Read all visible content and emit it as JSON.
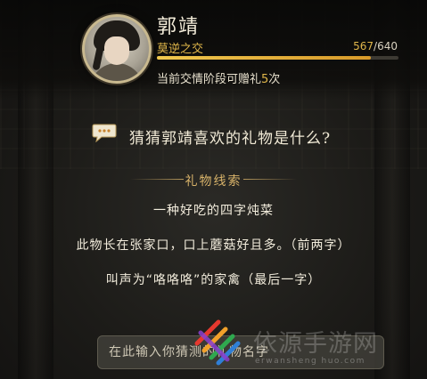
{
  "character": {
    "name": "郭靖",
    "stage": "莫逆之交",
    "favor_current": "567",
    "favor_max": "640",
    "favor_fraction": 0.886,
    "gift_text": "当前交情阶段可赠礼",
    "gift_count": "5",
    "gift_unit": "次"
  },
  "quiz": {
    "question": "猜猜郭靖喜欢的礼物是什么?",
    "clue_title": "礼物线索",
    "clues": [
      "一种好吃的四字炖菜",
      "此物长在张家口，口上蘑菇好且多。（前两字）",
      "叫声为“咯咯咯”的家禽（最后一字）"
    ]
  },
  "input": {
    "placeholder": "在此输入你猜测的礼物名字"
  },
  "watermark": {
    "text": "依源手游网",
    "sub": "erwansheng huo.com"
  },
  "colors": {
    "accent_gold": "#e0b64a",
    "clue_gold": "#d8b36a"
  }
}
